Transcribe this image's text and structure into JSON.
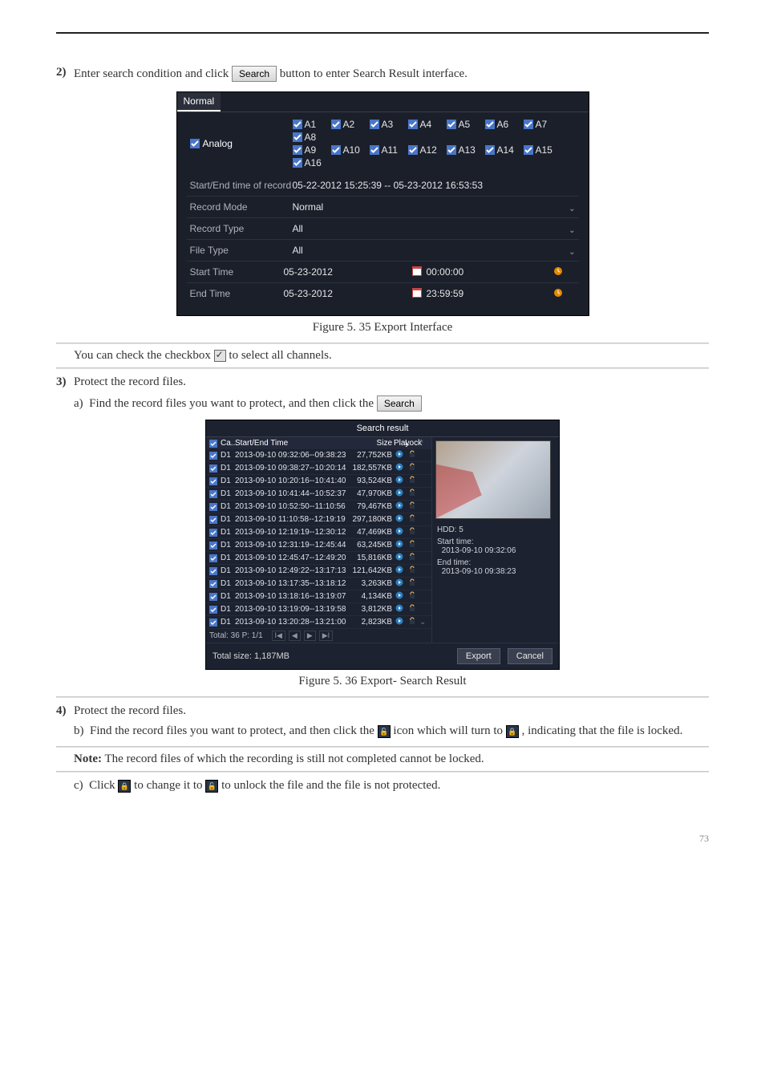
{
  "step2_text": "Enter search condition and click ",
  "search_btn": "Search",
  "step2_tail": " button to enter Search Result interface.",
  "fig35": "Figure 5. 35  Export Interface",
  "fig36": "Figure 5. 36  Export- Search Result",
  "step3_text": "Protect the record files.",
  "step3_sub1": "Find the record files you want to protect, and then click the ",
  "step3_sub1b": " icon which will turn to ",
  "step3_sub1c": ", indicating that the file is locked.",
  "note_label": "Note:",
  "note_body": "The record files of which the recording is still not completed cannot be locked.",
  "step3_sub2a": "Click ",
  "step3_sub2b": " to change it to ",
  "step3_sub2c": " to unlock the file and the file is not protected.",
  "normal": {
    "tab": "Normal",
    "analog_label": "Analog",
    "cams_row1": [
      "A1",
      "A2",
      "A3",
      "A4",
      "A5",
      "A6",
      "A7",
      "A8"
    ],
    "cams_row2": [
      "A9",
      "A10",
      "A11",
      "A12",
      "A13",
      "A14",
      "A15",
      "A16"
    ],
    "rows": {
      "se_label": "Start/End time of record",
      "se_value": "05-22-2012 15:25:39  --  05-23-2012 16:53:53",
      "mode_label": "Record Mode",
      "mode_value": "Normal",
      "type_label": "Record Type",
      "type_value": "All",
      "file_label": "File Type",
      "file_value": "All",
      "start_label": "Start Time",
      "start_date": "05-23-2012",
      "start_time": "00:00:00",
      "end_label": "End Time",
      "end_date": "05-23-2012",
      "end_time": "23:59:59"
    }
  },
  "inline_check_note": "You can check the checkbox ",
  "inline_check_tail": " to select all channels.",
  "sr": {
    "title": "Search result",
    "head": {
      "cam": "Ca...",
      "se": "Start/End Time",
      "size": "Size",
      "play": "Play",
      "lock": "Lock"
    },
    "rows": [
      {
        "cam": "D1",
        "t": "2013-09-10 09:32:06--09:38:23",
        "s": "27,752KB"
      },
      {
        "cam": "D1",
        "t": "2013-09-10 09:38:27--10:20:14",
        "s": "182,557KB"
      },
      {
        "cam": "D1",
        "t": "2013-09-10 10:20:16--10:41:40",
        "s": "93,524KB"
      },
      {
        "cam": "D1",
        "t": "2013-09-10 10:41:44--10:52:37",
        "s": "47,970KB"
      },
      {
        "cam": "D1",
        "t": "2013-09-10 10:52:50--11:10:56",
        "s": "79,467KB"
      },
      {
        "cam": "D1",
        "t": "2013-09-10 11:10:58--12:19:19",
        "s": "297,180KB"
      },
      {
        "cam": "D1",
        "t": "2013-09-10 12:19:19--12:30:12",
        "s": "47,469KB"
      },
      {
        "cam": "D1",
        "t": "2013-09-10 12:31:19--12:45:44",
        "s": "63,245KB"
      },
      {
        "cam": "D1",
        "t": "2013-09-10 12:45:47--12:49:20",
        "s": "15,816KB"
      },
      {
        "cam": "D1",
        "t": "2013-09-10 12:49:22--13:17:13",
        "s": "121,642KB"
      },
      {
        "cam": "D1",
        "t": "2013-09-10 13:17:35--13:18:12",
        "s": "3,263KB"
      },
      {
        "cam": "D1",
        "t": "2013-09-10 13:18:16--13:19:07",
        "s": "4,134KB"
      },
      {
        "cam": "D1",
        "t": "2013-09-10 13:19:09--13:19:58",
        "s": "3,812KB"
      },
      {
        "cam": "D1",
        "t": "2013-09-10 13:20:28--13:21:00",
        "s": "2,823KB"
      }
    ],
    "pager": "Total: 36  P: 1/1",
    "total": "Total size: 1,187MB",
    "hdd_label": "HDD: 5",
    "start_label": "Start time:",
    "start_val": "2013-09-10 09:32:06",
    "end_label": "End time:",
    "end_val": "2013-09-10 09:38:23",
    "export": "Export",
    "cancel": "Cancel"
  },
  "page_num": "73"
}
